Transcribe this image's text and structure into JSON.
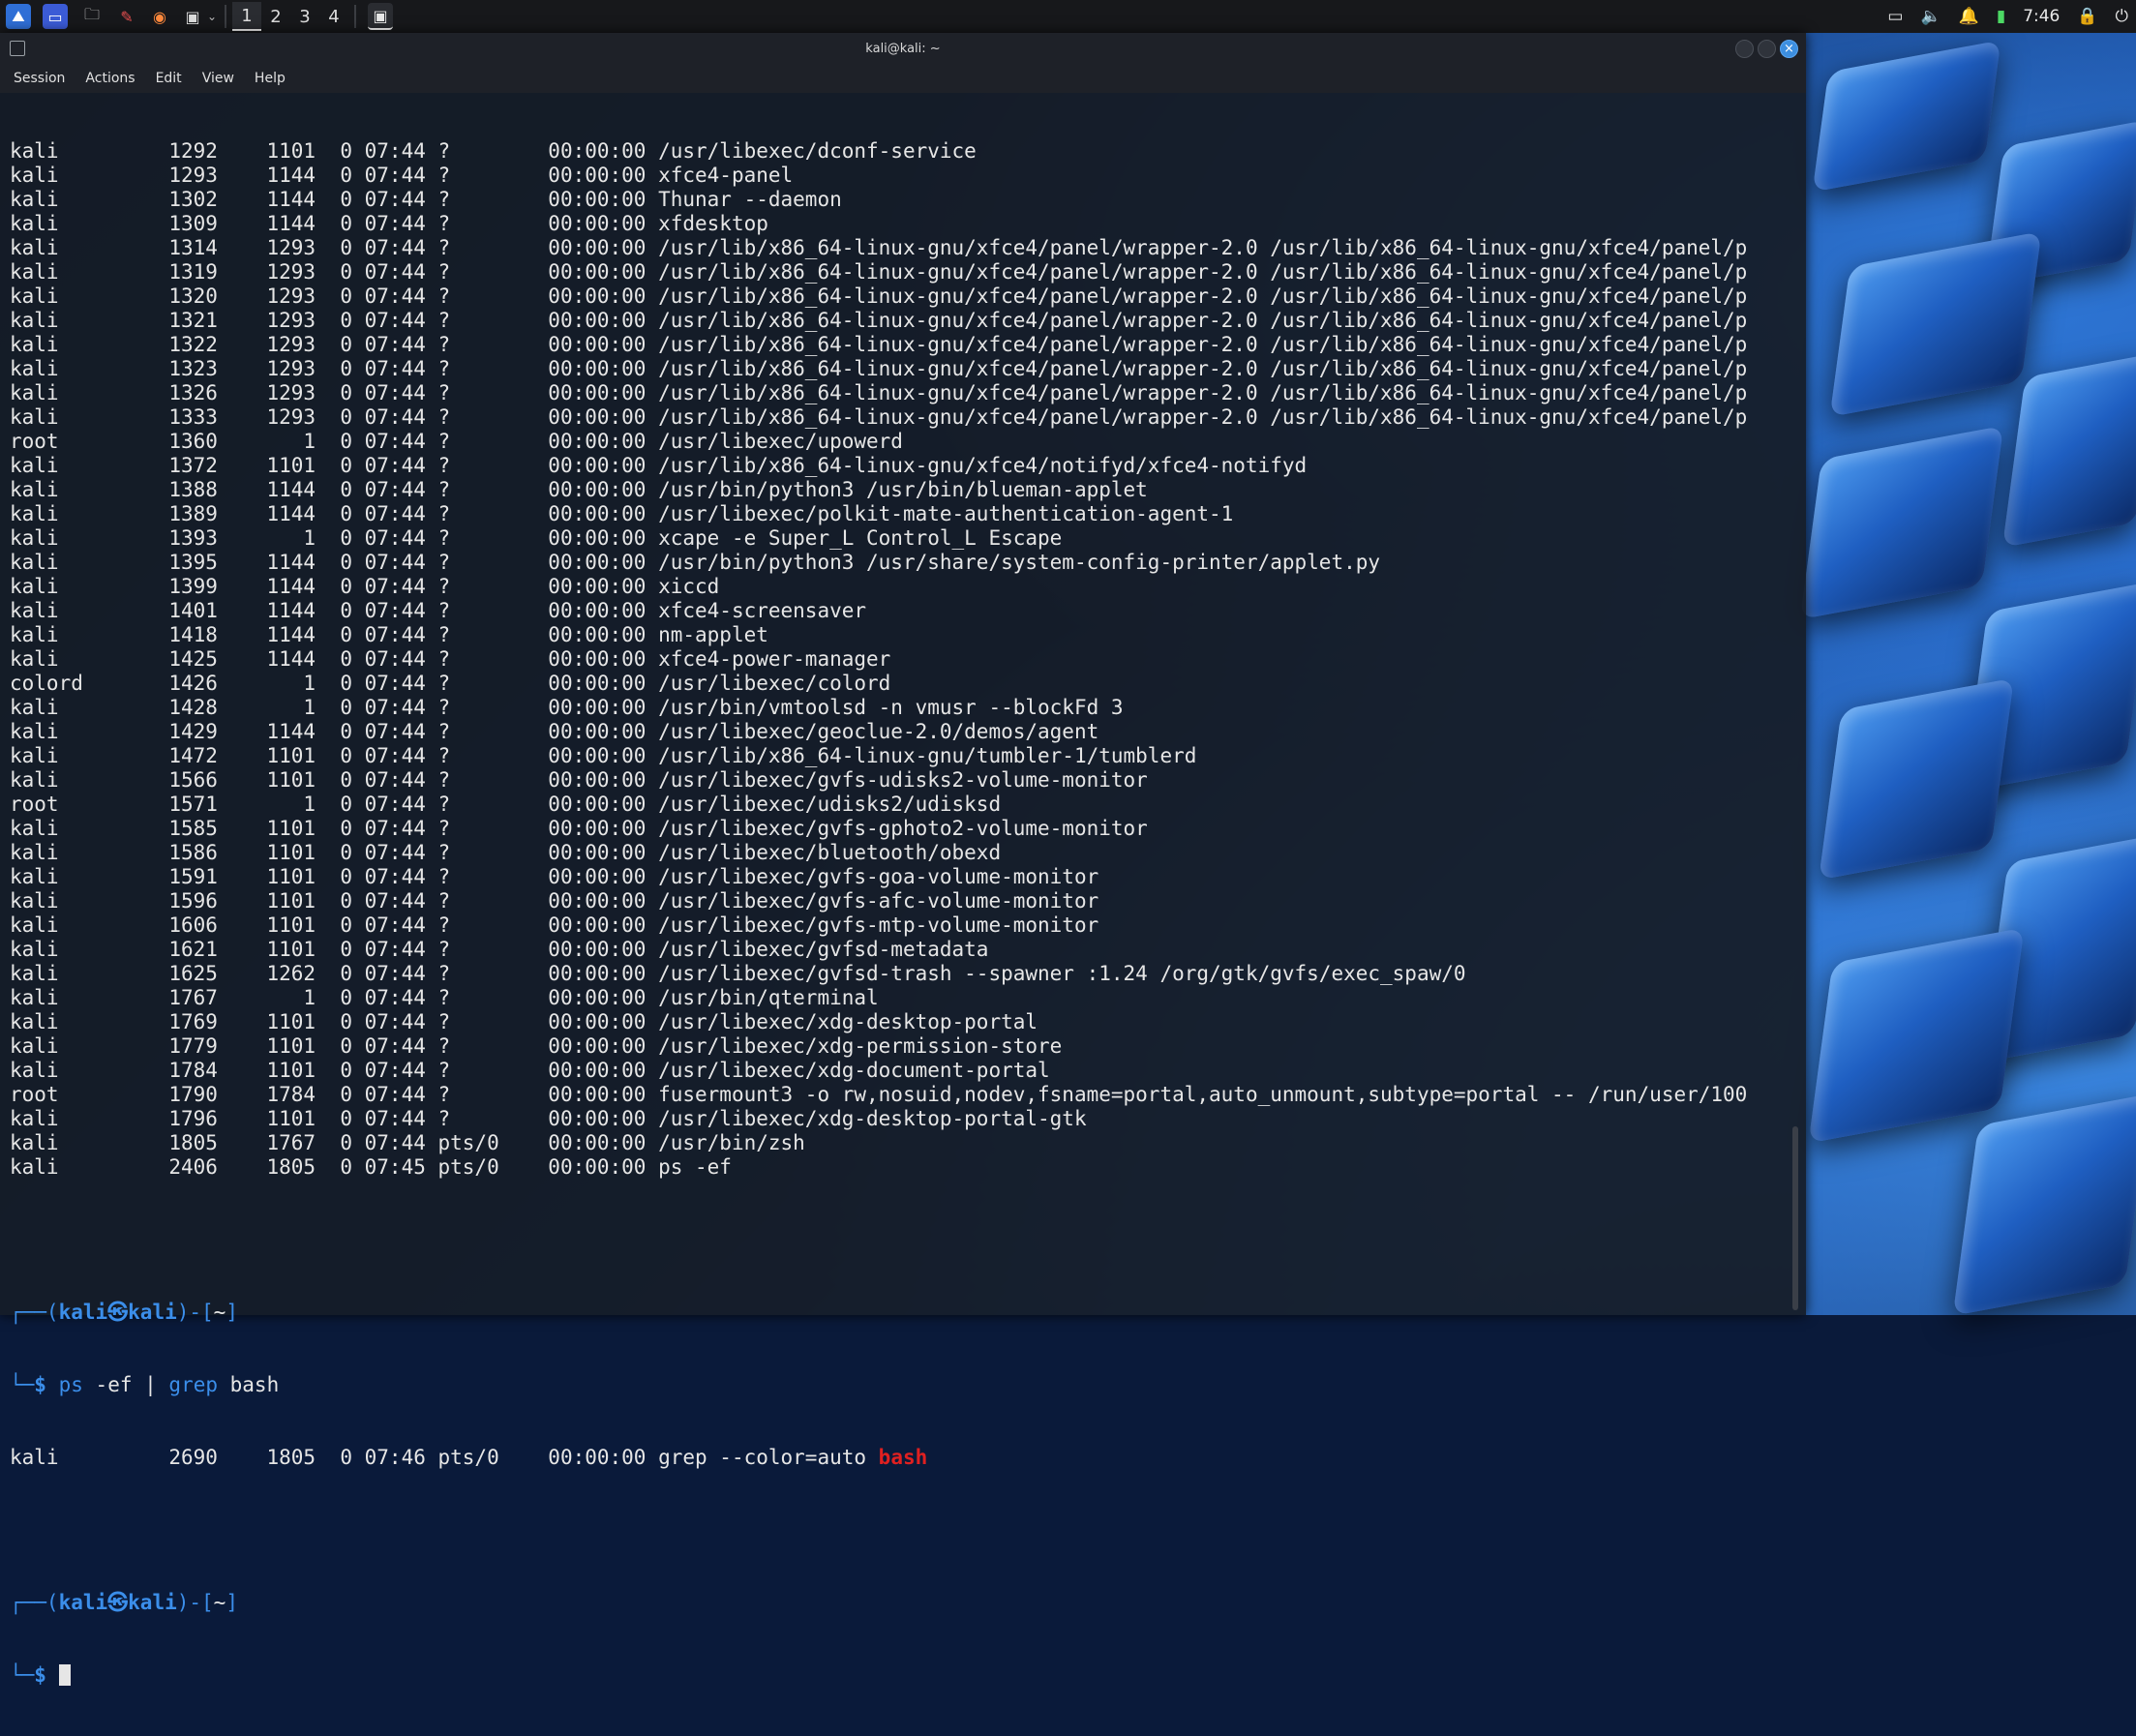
{
  "panel": {
    "workspaces": [
      "1",
      "2",
      "3",
      "4"
    ],
    "active_workspace": "1",
    "clock": "7:46",
    "launchers": [
      "kali-menu-icon",
      "desktop-icon",
      "file-manager-icon",
      "text-editor-icon",
      "firefox-icon",
      "terminal-icon"
    ]
  },
  "window": {
    "title": "kali@kali: ~",
    "menu": [
      "Session",
      "Actions",
      "Edit",
      "View",
      "Help"
    ]
  },
  "processes": [
    [
      "kali",
      "1292",
      "1101",
      "0",
      "07:44",
      "?",
      "00:00:00",
      "/usr/libexec/dconf-service"
    ],
    [
      "kali",
      "1293",
      "1144",
      "0",
      "07:44",
      "?",
      "00:00:00",
      "xfce4-panel"
    ],
    [
      "kali",
      "1302",
      "1144",
      "0",
      "07:44",
      "?",
      "00:00:00",
      "Thunar --daemon"
    ],
    [
      "kali",
      "1309",
      "1144",
      "0",
      "07:44",
      "?",
      "00:00:00",
      "xfdesktop"
    ],
    [
      "kali",
      "1314",
      "1293",
      "0",
      "07:44",
      "?",
      "00:00:00",
      "/usr/lib/x86_64-linux-gnu/xfce4/panel/wrapper-2.0 /usr/lib/x86_64-linux-gnu/xfce4/panel/p"
    ],
    [
      "kali",
      "1319",
      "1293",
      "0",
      "07:44",
      "?",
      "00:00:00",
      "/usr/lib/x86_64-linux-gnu/xfce4/panel/wrapper-2.0 /usr/lib/x86_64-linux-gnu/xfce4/panel/p"
    ],
    [
      "kali",
      "1320",
      "1293",
      "0",
      "07:44",
      "?",
      "00:00:00",
      "/usr/lib/x86_64-linux-gnu/xfce4/panel/wrapper-2.0 /usr/lib/x86_64-linux-gnu/xfce4/panel/p"
    ],
    [
      "kali",
      "1321",
      "1293",
      "0",
      "07:44",
      "?",
      "00:00:00",
      "/usr/lib/x86_64-linux-gnu/xfce4/panel/wrapper-2.0 /usr/lib/x86_64-linux-gnu/xfce4/panel/p"
    ],
    [
      "kali",
      "1322",
      "1293",
      "0",
      "07:44",
      "?",
      "00:00:00",
      "/usr/lib/x86_64-linux-gnu/xfce4/panel/wrapper-2.0 /usr/lib/x86_64-linux-gnu/xfce4/panel/p"
    ],
    [
      "kali",
      "1323",
      "1293",
      "0",
      "07:44",
      "?",
      "00:00:00",
      "/usr/lib/x86_64-linux-gnu/xfce4/panel/wrapper-2.0 /usr/lib/x86_64-linux-gnu/xfce4/panel/p"
    ],
    [
      "kali",
      "1326",
      "1293",
      "0",
      "07:44",
      "?",
      "00:00:00",
      "/usr/lib/x86_64-linux-gnu/xfce4/panel/wrapper-2.0 /usr/lib/x86_64-linux-gnu/xfce4/panel/p"
    ],
    [
      "kali",
      "1333",
      "1293",
      "0",
      "07:44",
      "?",
      "00:00:00",
      "/usr/lib/x86_64-linux-gnu/xfce4/panel/wrapper-2.0 /usr/lib/x86_64-linux-gnu/xfce4/panel/p"
    ],
    [
      "root",
      "1360",
      "1",
      "0",
      "07:44",
      "?",
      "00:00:00",
      "/usr/libexec/upowerd"
    ],
    [
      "kali",
      "1372",
      "1101",
      "0",
      "07:44",
      "?",
      "00:00:00",
      "/usr/lib/x86_64-linux-gnu/xfce4/notifyd/xfce4-notifyd"
    ],
    [
      "kali",
      "1388",
      "1144",
      "0",
      "07:44",
      "?",
      "00:00:00",
      "/usr/bin/python3 /usr/bin/blueman-applet"
    ],
    [
      "kali",
      "1389",
      "1144",
      "0",
      "07:44",
      "?",
      "00:00:00",
      "/usr/libexec/polkit-mate-authentication-agent-1"
    ],
    [
      "kali",
      "1393",
      "1",
      "0",
      "07:44",
      "?",
      "00:00:00",
      "xcape -e Super_L Control_L Escape"
    ],
    [
      "kali",
      "1395",
      "1144",
      "0",
      "07:44",
      "?",
      "00:00:00",
      "/usr/bin/python3 /usr/share/system-config-printer/applet.py"
    ],
    [
      "kali",
      "1399",
      "1144",
      "0",
      "07:44",
      "?",
      "00:00:00",
      "xiccd"
    ],
    [
      "kali",
      "1401",
      "1144",
      "0",
      "07:44",
      "?",
      "00:00:00",
      "xfce4-screensaver"
    ],
    [
      "kali",
      "1418",
      "1144",
      "0",
      "07:44",
      "?",
      "00:00:00",
      "nm-applet"
    ],
    [
      "kali",
      "1425",
      "1144",
      "0",
      "07:44",
      "?",
      "00:00:00",
      "xfce4-power-manager"
    ],
    [
      "colord",
      "1426",
      "1",
      "0",
      "07:44",
      "?",
      "00:00:00",
      "/usr/libexec/colord"
    ],
    [
      "kali",
      "1428",
      "1",
      "0",
      "07:44",
      "?",
      "00:00:00",
      "/usr/bin/vmtoolsd -n vmusr --blockFd 3"
    ],
    [
      "kali",
      "1429",
      "1144",
      "0",
      "07:44",
      "?",
      "00:00:00",
      "/usr/libexec/geoclue-2.0/demos/agent"
    ],
    [
      "kali",
      "1472",
      "1101",
      "0",
      "07:44",
      "?",
      "00:00:00",
      "/usr/lib/x86_64-linux-gnu/tumbler-1/tumblerd"
    ],
    [
      "kali",
      "1566",
      "1101",
      "0",
      "07:44",
      "?",
      "00:00:00",
      "/usr/libexec/gvfs-udisks2-volume-monitor"
    ],
    [
      "root",
      "1571",
      "1",
      "0",
      "07:44",
      "?",
      "00:00:00",
      "/usr/libexec/udisks2/udisksd"
    ],
    [
      "kali",
      "1585",
      "1101",
      "0",
      "07:44",
      "?",
      "00:00:00",
      "/usr/libexec/gvfs-gphoto2-volume-monitor"
    ],
    [
      "kali",
      "1586",
      "1101",
      "0",
      "07:44",
      "?",
      "00:00:00",
      "/usr/libexec/bluetooth/obexd"
    ],
    [
      "kali",
      "1591",
      "1101",
      "0",
      "07:44",
      "?",
      "00:00:00",
      "/usr/libexec/gvfs-goa-volume-monitor"
    ],
    [
      "kali",
      "1596",
      "1101",
      "0",
      "07:44",
      "?",
      "00:00:00",
      "/usr/libexec/gvfs-afc-volume-monitor"
    ],
    [
      "kali",
      "1606",
      "1101",
      "0",
      "07:44",
      "?",
      "00:00:00",
      "/usr/libexec/gvfs-mtp-volume-monitor"
    ],
    [
      "kali",
      "1621",
      "1101",
      "0",
      "07:44",
      "?",
      "00:00:00",
      "/usr/libexec/gvfsd-metadata"
    ],
    [
      "kali",
      "1625",
      "1262",
      "0",
      "07:44",
      "?",
      "00:00:00",
      "/usr/libexec/gvfsd-trash --spawner :1.24 /org/gtk/gvfs/exec_spaw/0"
    ],
    [
      "kali",
      "1767",
      "1",
      "0",
      "07:44",
      "?",
      "00:00:00",
      "/usr/bin/qterminal"
    ],
    [
      "kali",
      "1769",
      "1101",
      "0",
      "07:44",
      "?",
      "00:00:00",
      "/usr/libexec/xdg-desktop-portal"
    ],
    [
      "kali",
      "1779",
      "1101",
      "0",
      "07:44",
      "?",
      "00:00:00",
      "/usr/libexec/xdg-permission-store"
    ],
    [
      "kali",
      "1784",
      "1101",
      "0",
      "07:44",
      "?",
      "00:00:00",
      "/usr/libexec/xdg-document-portal"
    ],
    [
      "root",
      "1790",
      "1784",
      "0",
      "07:44",
      "?",
      "00:00:00",
      "fusermount3 -o rw,nosuid,nodev,fsname=portal,auto_unmount,subtype=portal -- /run/user/100"
    ],
    [
      "kali",
      "1796",
      "1101",
      "0",
      "07:44",
      "?",
      "00:00:00",
      "/usr/libexec/xdg-desktop-portal-gtk"
    ],
    [
      "kali",
      "1805",
      "1767",
      "0",
      "07:44",
      "pts/0",
      "00:00:00",
      "/usr/bin/zsh"
    ],
    [
      "kali",
      "2406",
      "1805",
      "0",
      "07:45",
      "pts/0",
      "00:00:00",
      "ps -ef"
    ]
  ],
  "prompt1": {
    "head_open": "┌──(",
    "user": "kali",
    "at": "㉿",
    "host": "kali",
    "mid": ")-[",
    "dir": "~",
    "close": "]",
    "tail": "└─",
    "dollar": "$",
    "cmd_ps": "ps",
    "cmd_args": " -ef | ",
    "cmd_grep": "grep",
    "cmd_rest": " bash"
  },
  "grep_result": {
    "row": [
      "kali",
      "2690",
      "1805",
      "0",
      "07:46",
      "pts/0",
      "00:00:00"
    ],
    "cmd": "grep --color=auto ",
    "match": "bash"
  },
  "prompt2": {
    "head_open": "┌──(",
    "user": "kali",
    "at": "㉿",
    "host": "kali",
    "mid": ")-[",
    "dir": "~",
    "close": "]",
    "tail": "└─",
    "dollar": "$"
  }
}
